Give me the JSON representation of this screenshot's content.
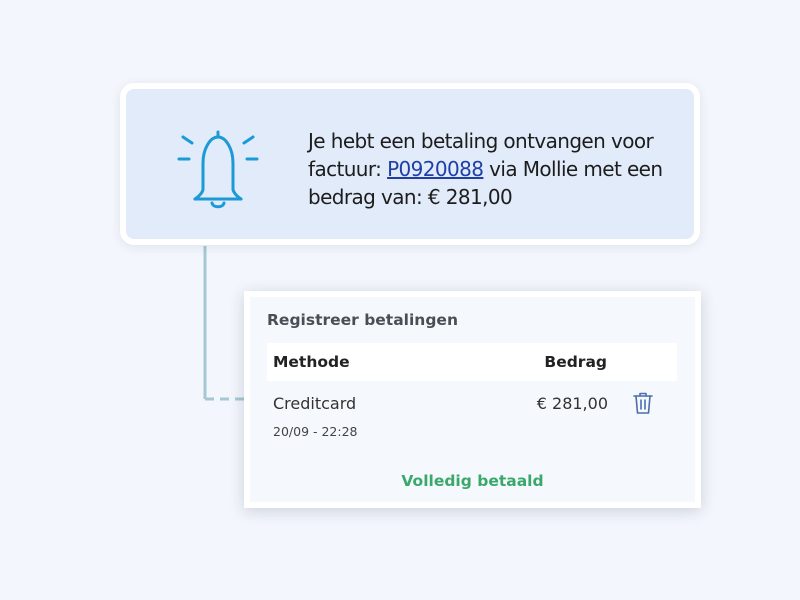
{
  "notification": {
    "icon": "bell-icon",
    "text_before": "Je hebt een betaling ontvangen voor factuur: ",
    "invoice_link": "P0920088",
    "text_after": " via Mollie met een bedrag van: € 281,00",
    "accent_color": "#1b9ad6"
  },
  "payments": {
    "title": "Registreer betalingen",
    "columns": {
      "method": "Methode",
      "amount": "Bedrag"
    },
    "rows": [
      {
        "method": "Creditcard",
        "date": "20/09 - 22:28",
        "amount": "€ 281,00",
        "delete_icon": "trash-icon"
      }
    ],
    "status": "Volledig betaald",
    "status_color": "#3aa86a"
  }
}
